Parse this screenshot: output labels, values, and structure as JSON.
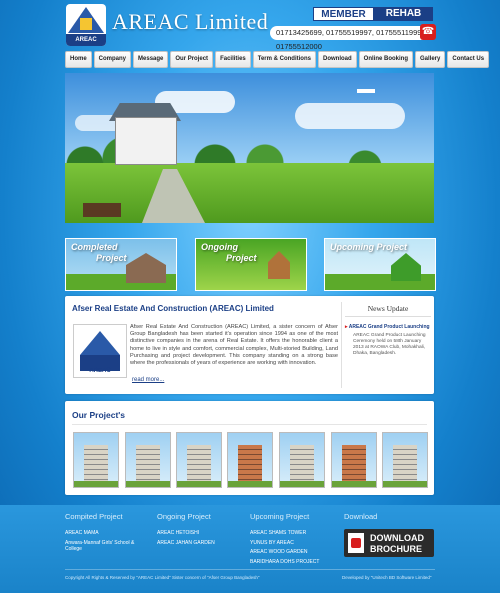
{
  "header": {
    "title": "AREAC Limited",
    "logo_text": "AREAC",
    "badge": {
      "member": "MEMBER",
      "rehab": "REHAB"
    },
    "phones": "01713425699, 01755519997, 01755511999, 01755512000",
    "phone_icon": "phone-icon"
  },
  "nav": [
    "Home",
    "Company",
    "Message",
    "Our Project",
    "Facilities",
    "Term & Conditions",
    "Download",
    "Online Booking",
    "Gallery",
    "Contact Us"
  ],
  "tiles": {
    "completed": {
      "l1": "Completed",
      "l2": "Project"
    },
    "ongoing": {
      "l1": "Ongoing",
      "l2": "Project"
    },
    "upcoming": {
      "l1": "Upcoming Project",
      "l2": ""
    }
  },
  "about": {
    "heading": "Afser Real Estate And Construction (AREAC) Limited",
    "logo_text": "AREAC",
    "body": "Afser Real Estate And Construction (AREAC) Limited, a sister concern of Afser Group Bangladesh has been started it's operation since 1994 as one of the most distinctive companies in the arena of Real Estate. It offers the honorable client a home to live in style and comfort, commercial complex, Multi-storied Building, Land Purchasing and project development. This company standing on a strong base where the professionals of years of experience are working with innovation.",
    "read_more": "read more..."
  },
  "news": {
    "heading": "News Update",
    "item_title": "AREAC Grand Product Launching",
    "item_body": "AREAC Grand Product Launching Ceremony held on 58th January 2013 at RAOWA Club, Mohakhali, Dhaka, Bangladesh."
  },
  "projects": {
    "heading": "Our Project's"
  },
  "footer": {
    "completed": {
      "heading": "Compited Project",
      "items": [
        "AREAC MAMA",
        "Anwara-Mannaf Girls&#x27; School & College"
      ]
    },
    "ongoing": {
      "heading": "Ongoing Project",
      "items": [
        "AREAC HETOISHI",
        "AREAC JAHAN GARDEN"
      ]
    },
    "upcoming": {
      "heading": "Upcoming Project",
      "items": [
        "AREAC SHAMS TOWER",
        "YUNUS BY AREAC",
        "AREAC WOOD GARDEN",
        "BARIDHARA DOHS PROJECT"
      ]
    },
    "download": {
      "heading": "Download",
      "l1": "DOWNLOAD",
      "l2": "BROCHURE"
    },
    "copyright": "Copyright All Rights & Reserved by \"AREAC Limited\" Sister concern of \"Afser Group Bangladesh\"",
    "developer": "Developed by \"Unitech BD Software Limited\""
  }
}
